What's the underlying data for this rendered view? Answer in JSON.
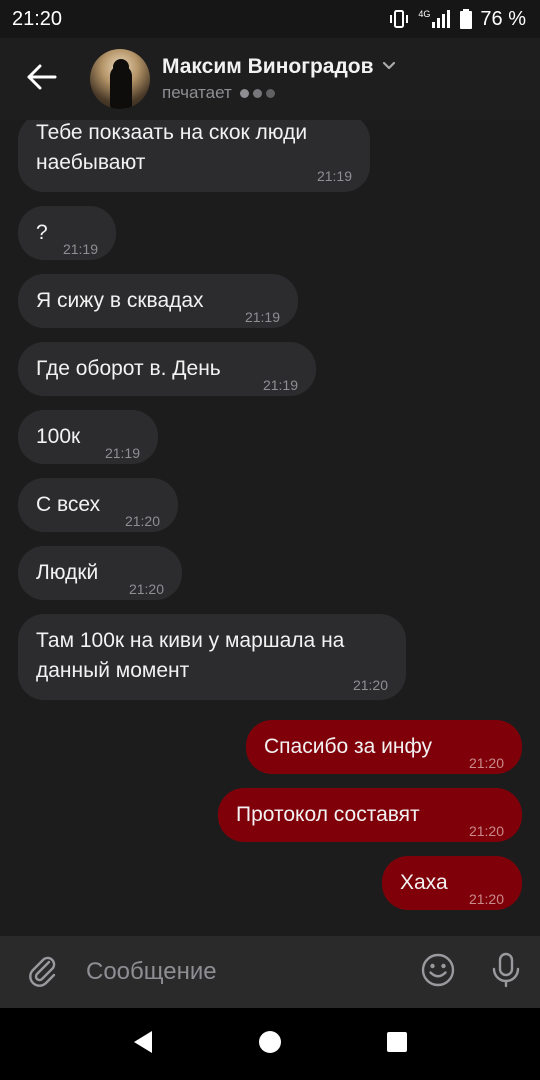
{
  "status_bar": {
    "time": "21:20",
    "network": "4G",
    "battery": "76 %",
    "icons": [
      "vibrate-icon",
      "signal-icon",
      "battery-icon"
    ]
  },
  "header": {
    "contact_name": "Максим Виноградов",
    "status": "печатает",
    "icons": [
      "back-arrow-icon",
      "chevron-down-icon",
      "typing-dots-icon"
    ]
  },
  "messages": [
    {
      "direction": "in",
      "text_lines": [
        "Тебе покзаать на скок люди",
        "наебывают"
      ],
      "time": "21:19"
    },
    {
      "direction": "in",
      "text_lines": [
        "?"
      ],
      "time": "21:19"
    },
    {
      "direction": "in",
      "text_lines": [
        "Я сижу в сквадах"
      ],
      "time": "21:19"
    },
    {
      "direction": "in",
      "text_lines": [
        "Где оборот в. День"
      ],
      "time": "21:19"
    },
    {
      "direction": "in",
      "text_lines": [
        "100к"
      ],
      "time": "21:19"
    },
    {
      "direction": "in",
      "text_lines": [
        "С всех"
      ],
      "time": "21:20"
    },
    {
      "direction": "in",
      "text_lines": [
        "Людкй"
      ],
      "time": "21:20"
    },
    {
      "direction": "in",
      "text_lines": [
        "Там 100к на киви у маршала на",
        "данный момент"
      ],
      "time": "21:20"
    },
    {
      "direction": "out",
      "text_lines": [
        "Спасибо за инфу"
      ],
      "time": "21:20"
    },
    {
      "direction": "out",
      "text_lines": [
        "Протокол составят"
      ],
      "time": "21:20"
    },
    {
      "direction": "out",
      "text_lines": [
        "Хаха"
      ],
      "time": "21:20"
    }
  ],
  "composer": {
    "placeholder": "Сообщение",
    "value": "",
    "icons": [
      "paperclip-icon",
      "emoji-icon",
      "microphone-icon"
    ]
  },
  "nav_bar": {
    "icons": [
      "back-triangle-icon",
      "home-circle-icon",
      "recents-square-icon"
    ]
  },
  "colors": {
    "background": "#1c1c1d",
    "incoming_bubble": "#2c2c2e",
    "outgoing_bubble": "#80000a",
    "timestamp": "#8e8e93"
  }
}
